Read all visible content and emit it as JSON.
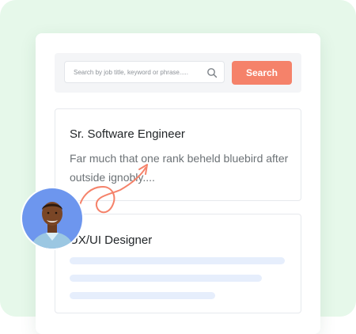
{
  "search": {
    "placeholder": "Search by job title, keyword or phrase.....",
    "button_label": "Search"
  },
  "jobs": [
    {
      "title": "Sr. Software Engineer",
      "description": "Far much that one rank beheld bluebird after outside ignobly...."
    },
    {
      "title": "UX/UI Designer"
    }
  ],
  "colors": {
    "background": "#e6f8ea",
    "accent": "#f5826a",
    "skeleton": "#e6eefc"
  },
  "icons": {
    "search": "search-icon",
    "avatar": "avatar",
    "pointer": "curly-arrow-icon"
  }
}
